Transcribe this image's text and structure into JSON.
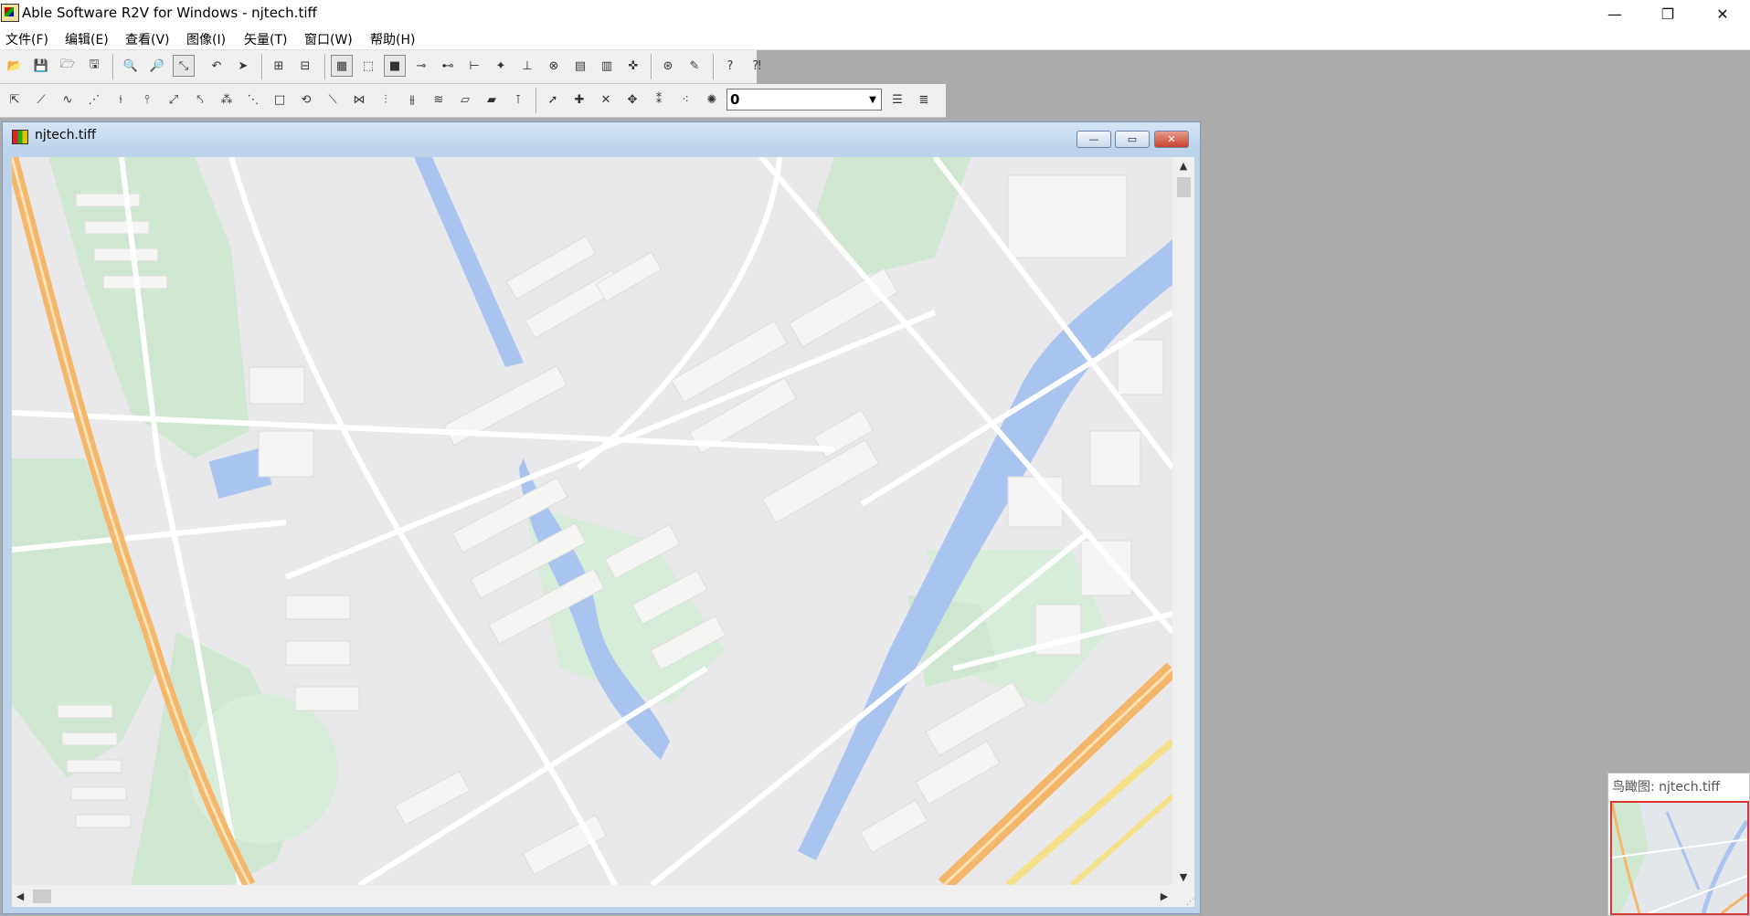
{
  "window": {
    "title": "Able Software R2V for Windows - njtech.tiff",
    "controls": {
      "minimize": "—",
      "restore": "❐",
      "close": "✕"
    }
  },
  "menu": {
    "items": [
      {
        "label": "文件(F)"
      },
      {
        "label": "编辑(E)"
      },
      {
        "label": "查看(V)"
      },
      {
        "label": "图像(I)"
      },
      {
        "label": "矢量(T)"
      },
      {
        "label": "窗口(W)"
      },
      {
        "label": "帮助(H)"
      }
    ]
  },
  "toolbar2": {
    "layer_select": {
      "value": "0"
    }
  },
  "document": {
    "title": "njtech.tiff",
    "controls": {
      "minimize": "—",
      "maximize": "▭",
      "close": "✕"
    }
  },
  "birdseye": {
    "title": "鸟瞰图: njtech.tiff"
  },
  "colors": {
    "road_orange": "#f4b66b",
    "road_yellow": "#f5e08a",
    "water": "#a9c4ef",
    "green": "#cfe7d1",
    "building": "#f5f5f3",
    "ground": "#e9e9ec"
  }
}
